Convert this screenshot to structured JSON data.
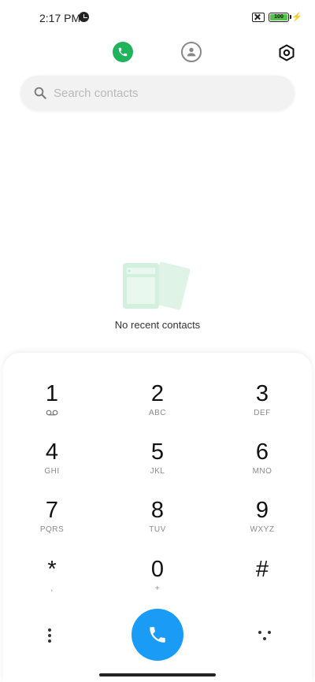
{
  "status_bar": {
    "time": "2:17 PM",
    "battery_level": "100",
    "icons": [
      "clock-icon",
      "no-sim-icon",
      "battery-icon",
      "charging-icon"
    ]
  },
  "tabs": [
    {
      "name": "recents",
      "icon": "phone-icon",
      "active": true,
      "accent": "#1fb35b"
    },
    {
      "name": "contacts",
      "icon": "contact-icon",
      "active": false
    }
  ],
  "search": {
    "placeholder": "Search contacts",
    "value": ""
  },
  "empty_state": {
    "message": "No recent contacts"
  },
  "dialpad": {
    "keys": [
      {
        "digit": "1",
        "letters": ""
      },
      {
        "digit": "2",
        "letters": "ABC"
      },
      {
        "digit": "3",
        "letters": "DEF"
      },
      {
        "digit": "4",
        "letters": "GHI"
      },
      {
        "digit": "5",
        "letters": "JKL"
      },
      {
        "digit": "6",
        "letters": "MNO"
      },
      {
        "digit": "7",
        "letters": "PQRS"
      },
      {
        "digit": "8",
        "letters": "TUV"
      },
      {
        "digit": "9",
        "letters": "WXYZ"
      },
      {
        "digit": "*",
        "letters": ","
      },
      {
        "digit": "0",
        "letters": "+"
      },
      {
        "digit": "#",
        "letters": ""
      }
    ],
    "call_button_color": "#1a9bf5"
  }
}
